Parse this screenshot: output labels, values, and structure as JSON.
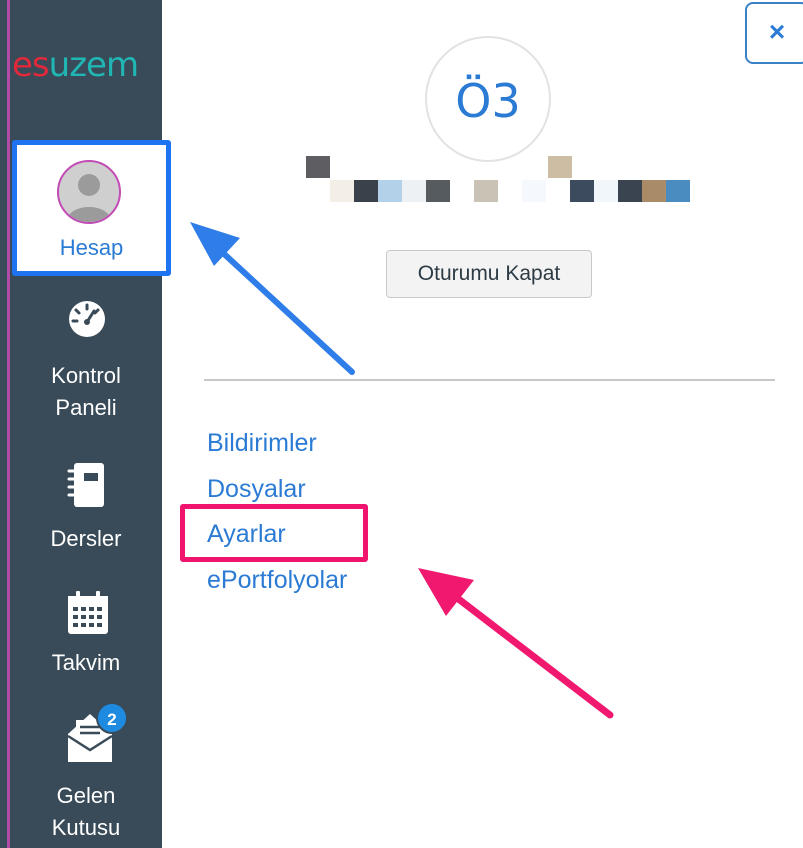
{
  "sidebar": {
    "logo_part1": "es",
    "logo_part2": "uzem",
    "items": [
      {
        "label": "Hesap",
        "icon": "user-avatar-icon"
      },
      {
        "label_line1": "Kontrol",
        "label_line2": "Paneli",
        "icon": "dashboard-gauge-icon"
      },
      {
        "label": "Dersler",
        "icon": "notebook-icon"
      },
      {
        "label": "Takvim",
        "icon": "calendar-icon"
      },
      {
        "label_line1": "Gelen",
        "label_line2": "Kutusu",
        "icon": "inbox-envelope-icon",
        "badge": "2"
      }
    ]
  },
  "panel": {
    "close_label": "×",
    "user_initials": "Ö3",
    "logout_label": "Oturumu Kapat",
    "links": [
      "Bildirimler",
      "Dosyalar",
      "Ayarlar",
      "ePortfolyolar"
    ]
  },
  "colors": {
    "sidebar_bg": "#394b58",
    "link_blue": "#2b7bd4",
    "highlight_blue": "#1e73f0",
    "highlight_pink": "#f0146e",
    "logo_red": "#e0293b",
    "logo_teal": "#1fb6b4"
  }
}
